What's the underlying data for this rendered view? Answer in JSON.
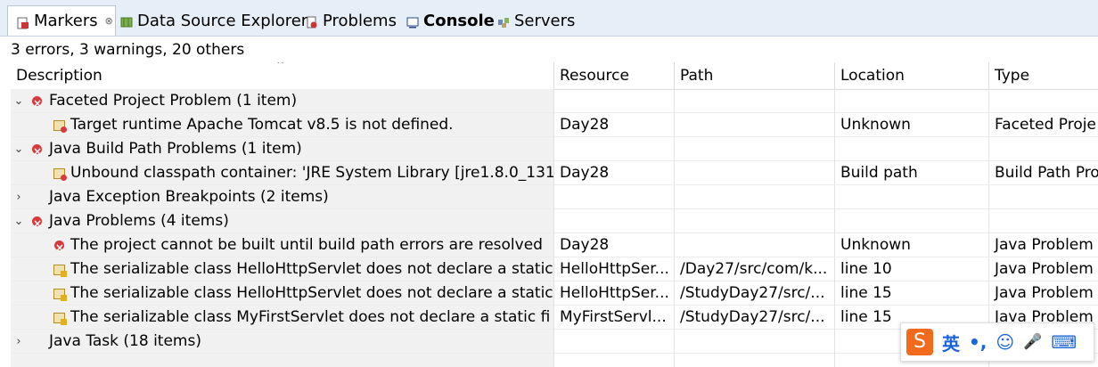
{
  "tabs": [
    {
      "label": "Markers",
      "icon": "markers-icon",
      "active": true,
      "close": "⊗"
    },
    {
      "label": "Data Source Explorer",
      "icon": "data-source-icon"
    },
    {
      "label": "Problems",
      "icon": "problems-icon"
    },
    {
      "label": "Console",
      "icon": "console-icon",
      "bold": true
    },
    {
      "label": "Servers",
      "icon": "servers-icon"
    }
  ],
  "summary": "3 errors, 3 warnings, 20 others",
  "columns": [
    "Description",
    "Resource",
    "Path",
    "Location",
    "Type"
  ],
  "sort_indicator": "^",
  "rows": [
    {
      "group": true,
      "expanded": true,
      "icon": "error",
      "desc": "Faceted Project Problem (1 item)",
      "res": "",
      "path": "",
      "loc": "",
      "type": ""
    },
    {
      "group": false,
      "icon": "marker-err",
      "desc": "Target runtime Apache Tomcat v8.5 is not defined.",
      "res": "Day28",
      "path": "",
      "loc": "Unknown",
      "type": "Faceted Proje"
    },
    {
      "group": true,
      "expanded": true,
      "icon": "error",
      "desc": "Java Build Path Problems (1 item)",
      "res": "",
      "path": "",
      "loc": "",
      "type": ""
    },
    {
      "group": false,
      "icon": "marker-err",
      "desc": "Unbound classpath container: 'JRE System Library [jre1.8.0_131",
      "res": "Day28",
      "path": "",
      "loc": "Build path",
      "type": "Build Path Pro"
    },
    {
      "group": true,
      "expanded": false,
      "icon": "none",
      "desc": "Java Exception Breakpoints (2 items)",
      "res": "",
      "path": "",
      "loc": "",
      "type": ""
    },
    {
      "group": true,
      "expanded": true,
      "icon": "error",
      "desc": "Java Problems (4 items)",
      "res": "",
      "path": "",
      "loc": "",
      "type": ""
    },
    {
      "group": false,
      "icon": "error",
      "desc": "The project cannot be built until build path errors are resolved",
      "res": "Day28",
      "path": "",
      "loc": "Unknown",
      "type": "Java Problem"
    },
    {
      "group": false,
      "icon": "marker-warn",
      "desc": "The serializable class HelloHttpServlet does not declare a static",
      "res": "HelloHttpSer...",
      "path": "/Day27/src/com/k...",
      "loc": "line 10",
      "type": "Java Problem"
    },
    {
      "group": false,
      "icon": "marker-warn",
      "desc": "The serializable class HelloHttpServlet does not declare a static",
      "res": "HelloHttpSer...",
      "path": "/StudyDay27/src/...",
      "loc": "line 15",
      "type": "Java Problem"
    },
    {
      "group": false,
      "icon": "marker-warn",
      "desc": "The serializable class MyFirstServlet does not declare a static fi",
      "res": "MyFirstServl...",
      "path": "/StudyDay27/src/...",
      "loc": "line 15",
      "type": "Java Problem"
    },
    {
      "group": true,
      "expanded": false,
      "icon": "none",
      "desc": "Java Task (18 items)",
      "res": "",
      "path": "",
      "loc": "",
      "type": ""
    }
  ],
  "ime": {
    "logo": "S",
    "lang": "英",
    "punct": "•,",
    "emoji": "☺",
    "mic": "🎤",
    "keyboard": "⌨"
  },
  "colors": {
    "tabbar": "#e6eef8",
    "error": "#d63a3a",
    "row_desc_bg": "#f1f1f1",
    "ime_logo": "#f26b1d",
    "ime_icons": "#1a63d8"
  }
}
